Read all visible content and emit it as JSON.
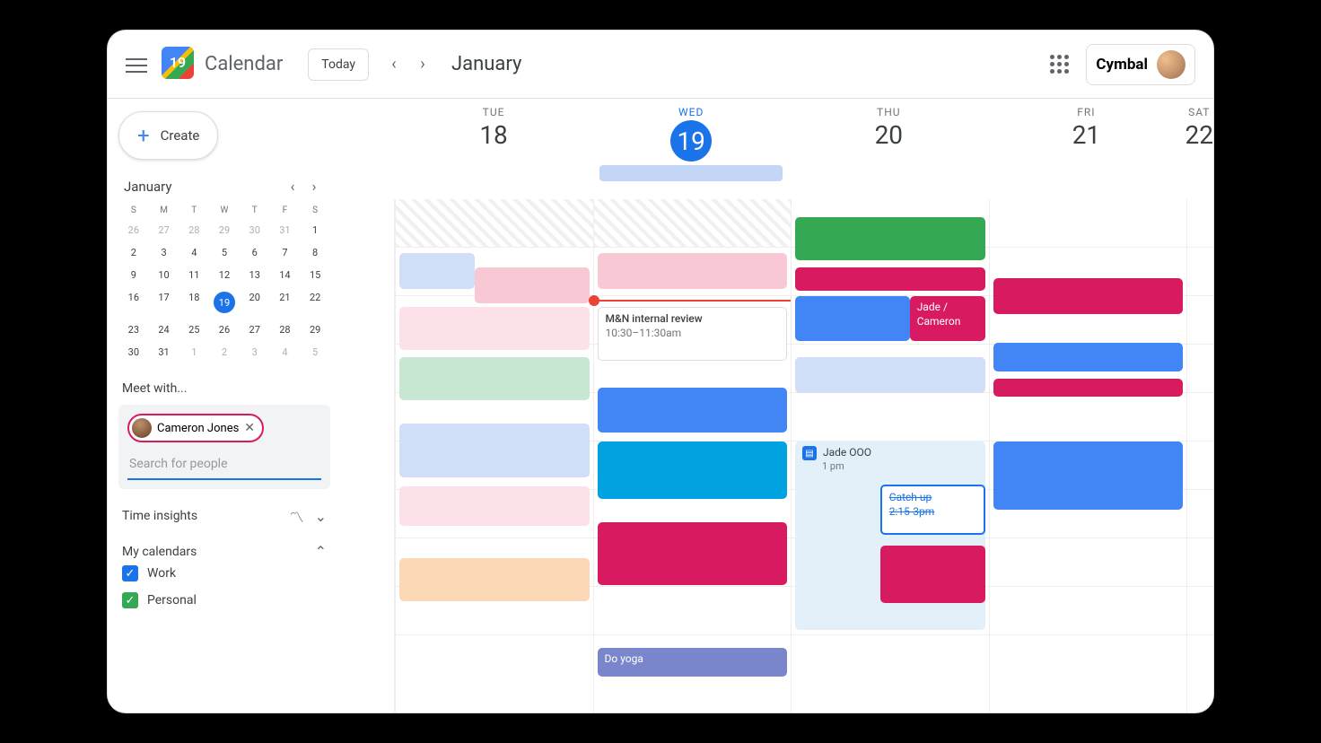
{
  "header": {
    "app_title": "Calendar",
    "logo_day": "19",
    "today_btn": "Today",
    "month": "January",
    "org": "Cymbal"
  },
  "create_label": "Create",
  "mini": {
    "month": "January",
    "dow": [
      "S",
      "M",
      "T",
      "W",
      "T",
      "F",
      "S"
    ],
    "weeks": [
      [
        {
          "n": "26",
          "o": 1
        },
        {
          "n": "27",
          "o": 1
        },
        {
          "n": "28",
          "o": 1
        },
        {
          "n": "29",
          "o": 1
        },
        {
          "n": "30",
          "o": 1
        },
        {
          "n": "31",
          "o": 1
        },
        {
          "n": "1"
        }
      ],
      [
        {
          "n": "2"
        },
        {
          "n": "3"
        },
        {
          "n": "4"
        },
        {
          "n": "5"
        },
        {
          "n": "6"
        },
        {
          "n": "7"
        },
        {
          "n": "8"
        }
      ],
      [
        {
          "n": "9"
        },
        {
          "n": "10"
        },
        {
          "n": "11"
        },
        {
          "n": "12"
        },
        {
          "n": "13"
        },
        {
          "n": "14"
        },
        {
          "n": "15"
        }
      ],
      [
        {
          "n": "16"
        },
        {
          "n": "17"
        },
        {
          "n": "18"
        },
        {
          "n": "19",
          "t": 1
        },
        {
          "n": "20"
        },
        {
          "n": "21"
        },
        {
          "n": "22"
        }
      ],
      [
        {
          "n": "23"
        },
        {
          "n": "24"
        },
        {
          "n": "25"
        },
        {
          "n": "26"
        },
        {
          "n": "27"
        },
        {
          "n": "28"
        },
        {
          "n": "29"
        }
      ],
      [
        {
          "n": "30"
        },
        {
          "n": "31"
        },
        {
          "n": "1",
          "o": 1
        },
        {
          "n": "2",
          "o": 1
        },
        {
          "n": "3",
          "o": 1
        },
        {
          "n": "4",
          "o": 1
        },
        {
          "n": "5",
          "o": 1
        }
      ]
    ]
  },
  "meet": {
    "heading": "Meet with...",
    "chip": "Cameron Jones",
    "placeholder": "Search for people"
  },
  "insights": "Time insights",
  "mycal": {
    "heading": "My calendars",
    "items": [
      {
        "label": "Work",
        "cls": "work"
      },
      {
        "label": "Personal",
        "cls": "pers"
      }
    ]
  },
  "days": [
    {
      "dow": "TUE",
      "num": "18"
    },
    {
      "dow": "WED",
      "num": "19",
      "today": true
    },
    {
      "dow": "THU",
      "num": "20"
    },
    {
      "dow": "FRI",
      "num": "21"
    },
    {
      "dow": "SAT",
      "num": "22"
    }
  ],
  "events": {
    "mn_title": "M&N internal review",
    "mn_time": "10:30–11:30am",
    "jade_cam": "Jade / Cameron",
    "jade_ooo": "Jade OOO",
    "jade_ooo_time": "1 pm",
    "catchup": "Catch up",
    "catchup_time": "2:15-3pm",
    "yoga": "Do yoga"
  }
}
